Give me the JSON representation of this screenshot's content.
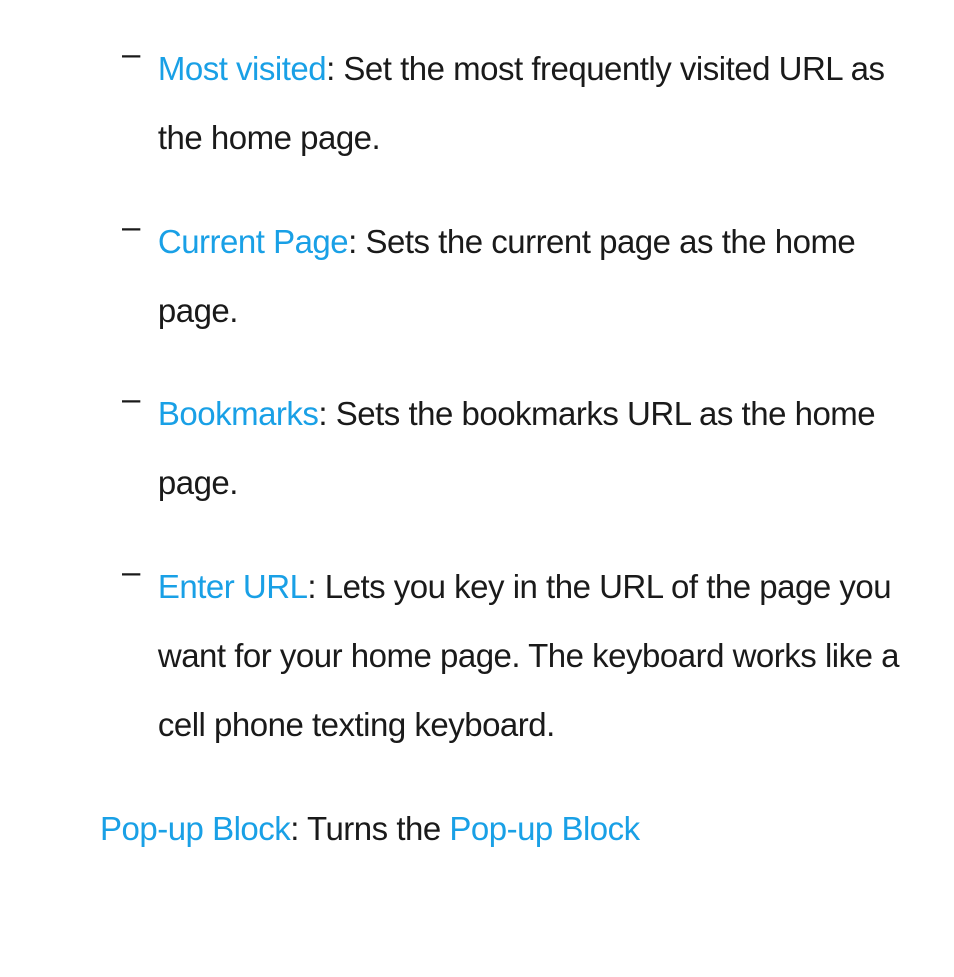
{
  "items": [
    {
      "dash": "–",
      "term": "Most visited",
      "desc": ": Set the most frequently visited URL as the home page."
    },
    {
      "dash": "–",
      "term": "Current Page",
      "desc": ": Sets the current page as the home page."
    },
    {
      "dash": "–",
      "term": "Bookmarks",
      "desc": ": Sets the bookmarks URL as the home page."
    },
    {
      "dash": "–",
      "term": "Enter URL",
      "desc": ": Lets you key in the URL of the page you want for your home page. The keyboard works like a cell phone texting keyboard."
    }
  ],
  "footer": {
    "term1": "Pop-up Block",
    "mid": ": Turns the ",
    "term2": "Pop-up Block"
  }
}
